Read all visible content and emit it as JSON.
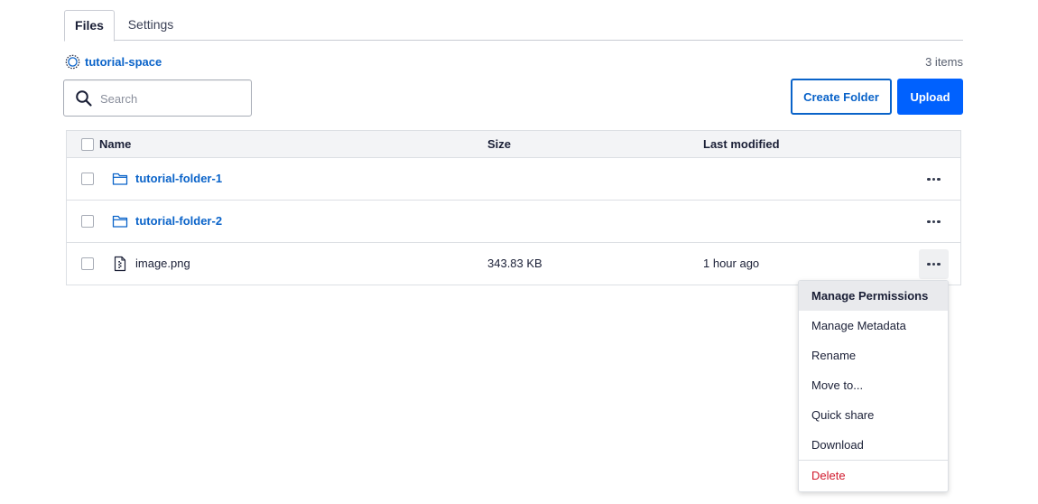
{
  "tabs": [
    {
      "label": "Files",
      "active": true
    },
    {
      "label": "Settings",
      "active": false
    }
  ],
  "breadcrumb": {
    "space_name": "tutorial-space",
    "icon": "space-icon"
  },
  "items_count": "3 items",
  "search": {
    "placeholder": "Search",
    "value": ""
  },
  "actions": {
    "create_folder": "Create Folder",
    "upload": "Upload"
  },
  "table": {
    "columns": [
      "Name",
      "Size",
      "Last modified"
    ],
    "rows": [
      {
        "type": "folder",
        "icon": "folder-icon",
        "name": "tutorial-folder-1",
        "size": "",
        "modified": ""
      },
      {
        "type": "folder",
        "icon": "folder-icon",
        "name": "tutorial-folder-2",
        "size": "",
        "modified": ""
      },
      {
        "type": "file",
        "icon": "file-icon",
        "name": "image.png",
        "size": "343.83 KB",
        "modified": "1 hour ago"
      }
    ]
  },
  "context_menu": {
    "items": [
      "Manage Permissions",
      "Manage Metadata",
      "Rename",
      "Move to...",
      "Quick share",
      "Download"
    ],
    "danger_item": "Delete"
  },
  "colors": {
    "accent": "#0061fe",
    "link": "#0a63c9",
    "danger": "#d0192c"
  }
}
